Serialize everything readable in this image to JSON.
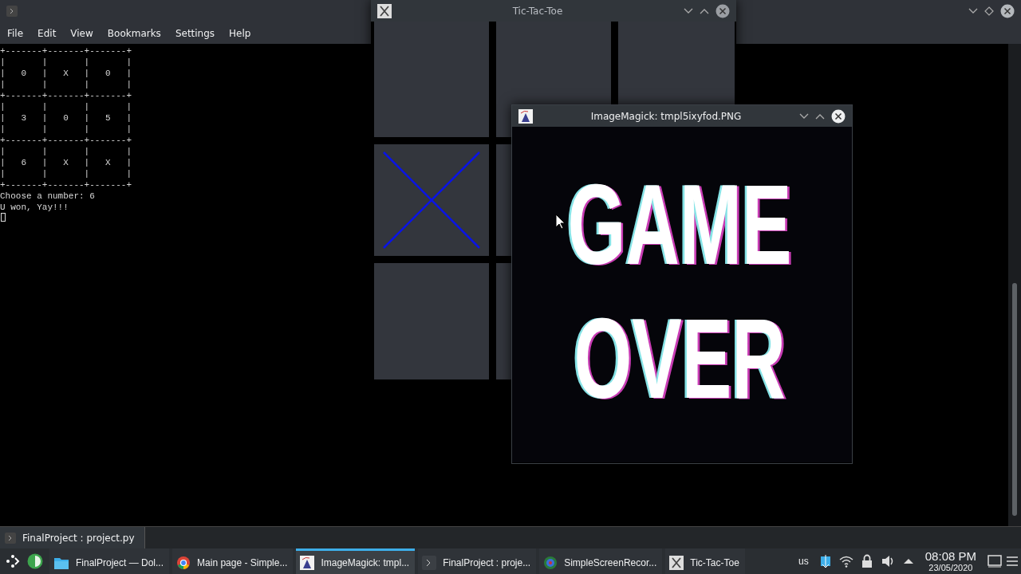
{
  "konsole": {
    "menu": [
      "File",
      "Edit",
      "View",
      "Bookmarks",
      "Settings",
      "Help"
    ],
    "terminal_lines": [
      "+-------+-------+-------+",
      "|       |       |       |",
      "|   0   |   X   |   0   |",
      "|       |       |       |",
      "+-------+-------+-------+",
      "|       |       |       |",
      "|   3   |   0   |   5   |",
      "|       |       |       |",
      "+-------+-------+-------+",
      "|       |       |       |",
      "|   6   |   X   |   X   |",
      "|       |       |       |",
      "+-------+-------+-------+",
      "Choose a number: 6",
      "U won, Yay!!!"
    ],
    "tab": {
      "label": "FinalProject : project.py",
      "selected": true
    }
  },
  "tictactoe_window": {
    "title": "Tic-Tac-Toe",
    "board_rows": [
      {
        "cells": [
          {
            "kind": "empty"
          },
          {
            "kind": "empty"
          },
          {
            "kind": "empty"
          }
        ]
      },
      {
        "cells": [
          {
            "kind": "cross"
          },
          {
            "kind": "empty"
          }
        ]
      },
      {
        "cells": [
          {
            "kind": "empty"
          },
          {
            "kind": "empty"
          }
        ]
      }
    ]
  },
  "imagemagick_window": {
    "title": "ImageMagick: tmpl5ixyfod.PNG",
    "image_text": [
      "GAME",
      "OVER"
    ]
  },
  "taskbar": {
    "tasks": [
      {
        "label": "FinalProject — Dol...",
        "kind": "folder",
        "active": false
      },
      {
        "label": "Main page - Simple...",
        "kind": "browser",
        "active": false
      },
      {
        "label": "ImageMagick: tmpl...",
        "kind": "viewer",
        "active": true
      },
      {
        "label": "FinalProject : proje...",
        "kind": "terminal",
        "active": false
      },
      {
        "label": "SimpleScreenRecor...",
        "kind": "recorder",
        "active": false
      },
      {
        "label": "Tic-Tac-Toe",
        "kind": "xapp",
        "active": false
      }
    ],
    "keyboard_layout": "us",
    "time": "08:08 PM",
    "date": "23/05/2020"
  }
}
